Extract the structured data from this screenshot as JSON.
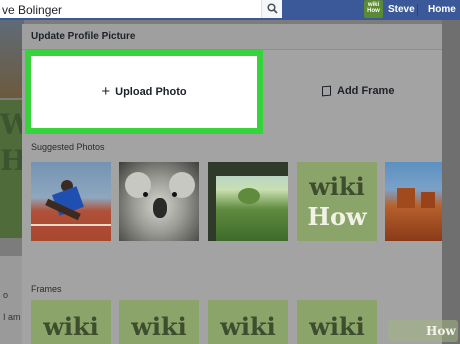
{
  "topbar": {
    "search_value": "ve Bolinger",
    "user_name": "Steve",
    "home_label": "Home",
    "avatar_text": "wiki How"
  },
  "background": {
    "profile_text": "Ho",
    "snippet_1": "o",
    "snippet_2": "I am"
  },
  "dialog": {
    "title": "Update Profile Picture",
    "upload_plus": "+",
    "upload_label": "Upload Photo",
    "frame_label": "Add Frame",
    "suggested_label": "Suggested Photos",
    "frames_label": "Frames",
    "suggested_photos": [
      {
        "kind": "runner-icon"
      },
      {
        "kind": "koala-icon"
      },
      {
        "kind": "field-icon"
      },
      {
        "kind": "wikihow-logo",
        "word1": "wiki",
        "word2": "How"
      },
      {
        "kind": "canyon-icon"
      }
    ],
    "frames": [
      {
        "word": "wiki"
      },
      {
        "word": "wiki"
      },
      {
        "word": "wiki"
      },
      {
        "word": "wiki"
      }
    ]
  },
  "watermark": {
    "text": "How"
  },
  "colors": {
    "nav_blue": "#3b5998",
    "highlight_green": "#36d33a",
    "wikihow_green": "#8ba46a"
  }
}
